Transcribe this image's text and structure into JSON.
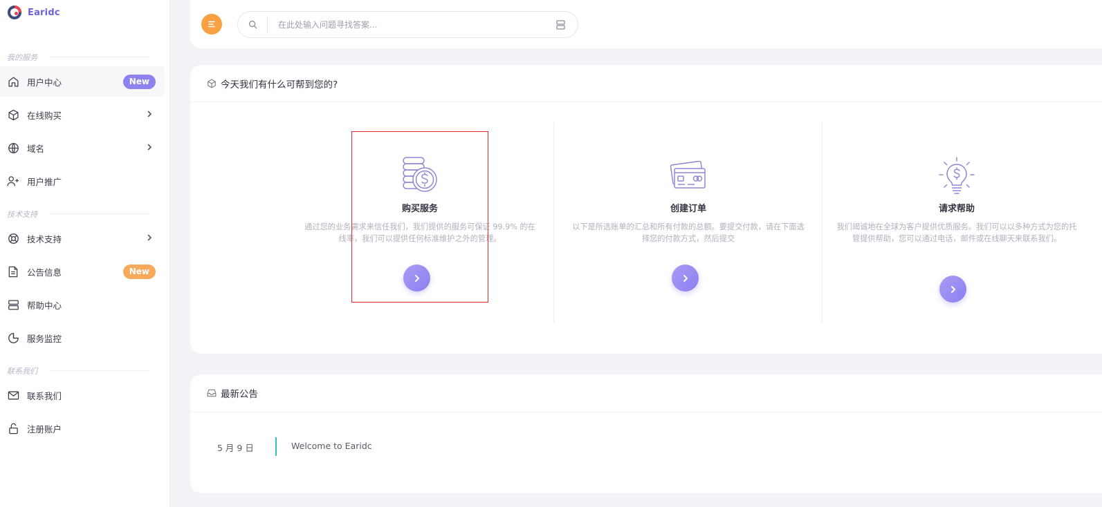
{
  "brand": {
    "name": "Earidc"
  },
  "sidebar": {
    "sections": [
      {
        "title": "我的服务"
      },
      {
        "title": "技术支持"
      },
      {
        "title": "联系我们"
      }
    ],
    "items": [
      {
        "label": "用户中心",
        "icon": "home-icon",
        "badge": "New"
      },
      {
        "label": "在线购买",
        "icon": "box-icon"
      },
      {
        "label": "域名",
        "icon": "globe-icon"
      },
      {
        "label": "用户推广",
        "icon": "user-plus-icon"
      },
      {
        "label": "技术支持",
        "icon": "lifebuoy-icon"
      },
      {
        "label": "公告信息",
        "icon": "document-icon",
        "badge": "New"
      },
      {
        "label": "帮助中心",
        "icon": "server-icon"
      },
      {
        "label": "服务监控",
        "icon": "pie-chart-icon"
      },
      {
        "label": "联系我们",
        "icon": "mail-icon"
      },
      {
        "label": "注册账户",
        "icon": "unlock-icon"
      }
    ]
  },
  "search": {
    "placeholder": "在此处输入问题寻找答案..."
  },
  "help": {
    "title": "今天我们有什么可帮到您的?",
    "columns": [
      {
        "title": "购买服务",
        "icon": "coins-dollar-icon",
        "description": "通过您的业务需求来信任我们，我们提供的服务可保证 99.9% 的在线率，我们可以提供任何标准维护之外的管理。"
      },
      {
        "title": "创建订单",
        "icon": "credit-cards-icon",
        "description": "以下是所选账单的汇总和所有付款的总额。要提交付款，请在下面选择您的付款方式，然后提交"
      },
      {
        "title": "请求帮助",
        "icon": "lightbulb-dollar-icon",
        "description": "我们竭诚地在全球为客户提供优质服务。我们可以以多种方式为您的托管提供帮助，您可以通过电话，邮件或在线聊天来联系我们。"
      }
    ]
  },
  "announcements": {
    "title": "最新公告",
    "items": [
      {
        "date": "5 月 9 日",
        "text": "Welcome to Earidc"
      }
    ]
  },
  "colors": {
    "accent": "#8b7ff0",
    "orange": "#f9a044",
    "teal": "#2bc4b0"
  }
}
